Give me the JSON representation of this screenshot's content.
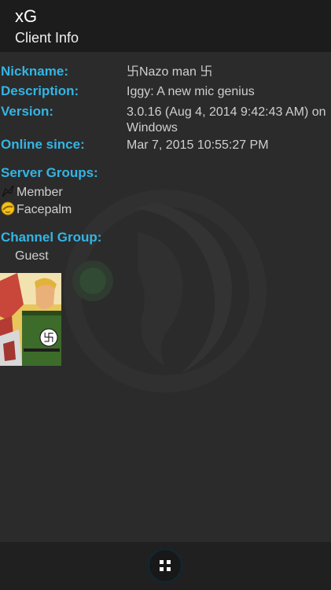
{
  "header": {
    "title": "xG",
    "subtitle": "Client Info"
  },
  "info": {
    "nickname_label": "Nickname:",
    "nickname_value": "卐Nazo man 卐",
    "description_label": "Description:",
    "description_value": "Iggy: A new mic genius",
    "version_label": "Version:",
    "version_value": "3.0.16 (Aug 4, 2014 9:42:43 AM) on Windows",
    "online_label": "Online since:",
    "online_value": "Mar 7, 2015 10:55:27 PM"
  },
  "server_groups": {
    "label": "Server Groups:",
    "items": [
      {
        "name": "Member",
        "icon": "member-icon"
      },
      {
        "name": "Facepalm",
        "icon": "facepalm-icon"
      }
    ]
  },
  "channel_group": {
    "label": "Channel Group:",
    "value": "Guest"
  },
  "colors": {
    "accent": "#33b5e5",
    "background": "#2b2b2b",
    "titlebar": "#1c1c1c"
  },
  "navigation": {
    "menu_icon": "grid-menu-icon"
  }
}
